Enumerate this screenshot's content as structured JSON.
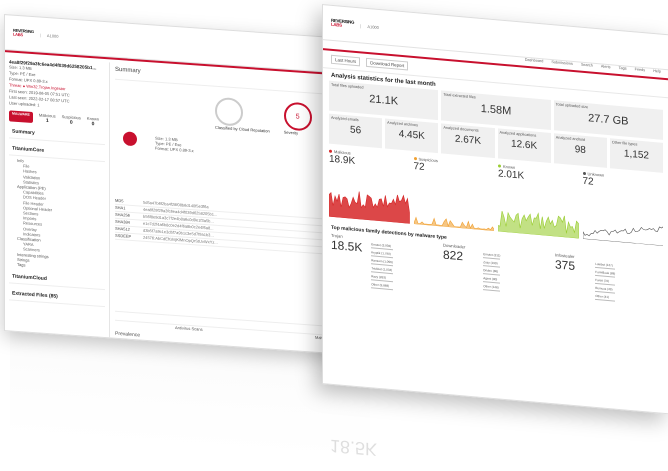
{
  "brand": {
    "logo_line1": "REVERSING",
    "logo_line2": "LABS",
    "product": "A1000"
  },
  "detail": {
    "hash": "4ea8f29f29a3fc6ea4d4f039d6258205b1...",
    "size": "Size: 1.3 MB",
    "type": "Type: PE / Exe",
    "format": "Format: UPX 0.89-3.x",
    "threat": "Threat: ● Win32.Trojan.Ingestor",
    "first_seen": "First seen: 2019-06-05 07:51 UTC",
    "last_seen": "Last seen: 2022-02-17 08:57 UTC",
    "uploaded": "User uploaded: 1",
    "status_pill": "MALWARE",
    "counts": [
      {
        "label": "Malicious",
        "value": "1"
      },
      {
        "label": "Suspicious",
        "value": "0"
      },
      {
        "label": "Known",
        "value": "0"
      }
    ],
    "nav": [
      {
        "kind": "sec",
        "label": "Summary"
      },
      {
        "kind": "sec",
        "label": "TitaniumCore"
      },
      {
        "kind": "sub",
        "label": "Info"
      },
      {
        "kind": "sub2",
        "label": "File"
      },
      {
        "kind": "sub2",
        "label": "Hashes"
      },
      {
        "kind": "sub2",
        "label": "Validation"
      },
      {
        "kind": "sub2",
        "label": "Statistics"
      },
      {
        "kind": "sub",
        "label": "Application (PE)"
      },
      {
        "kind": "sub2",
        "label": "Capabilities"
      },
      {
        "kind": "sub2",
        "label": "DOS Header"
      },
      {
        "kind": "sub2",
        "label": "File Header"
      },
      {
        "kind": "sub2",
        "label": "Optional Header"
      },
      {
        "kind": "sub2",
        "label": "Sections"
      },
      {
        "kind": "sub2",
        "label": "Imports"
      },
      {
        "kind": "sub2",
        "label": "Resources"
      },
      {
        "kind": "sub2",
        "label": "Overlay"
      },
      {
        "kind": "sub2",
        "label": "Indicators"
      },
      {
        "kind": "sub",
        "label": "Classification"
      },
      {
        "kind": "sub2",
        "label": "YARA"
      },
      {
        "kind": "sub2",
        "label": "Scanners"
      },
      {
        "kind": "sub",
        "label": "Interesting strings"
      },
      {
        "kind": "sub",
        "label": "Strings"
      },
      {
        "kind": "sub",
        "label": "Tags"
      },
      {
        "kind": "sec",
        "label": "TitaniumCloud"
      },
      {
        "kind": "sec",
        "label": "Extracted Files (85)"
      }
    ],
    "summary_title": "Summary",
    "file_size": "Size: 1.3 MB",
    "file_type": "Type: PE / Exe",
    "file_format": "Format: UPX 0.89-3.x",
    "malware_label": "MALWARE",
    "circle1_caption": "Classified by Cloud Reputation",
    "circle2_value": "5",
    "circle2_caption": "Severity",
    "circle3_value": "5",
    "hashes": [
      {
        "k": "MD5",
        "v": "5d5a47b6f2ba4f28f08b6d140f5e3f6a"
      },
      {
        "k": "SHA1",
        "v": "4ea8f29f29a3fc6ea4d4f039d6258205b1..."
      },
      {
        "k": "SHA256",
        "v": "b56f8e9d1a3c7f2e4b8a6c0d9e1f3a5b..."
      },
      {
        "k": "SHA384",
        "v": "e1c7d2f4a6b8c0e2d4f6a8b0c2e4f6a8..."
      },
      {
        "k": "SHA512",
        "v": "d3b5f7a9c1e3d5f7a9b1c3e5d7f9a1b3..."
      },
      {
        "k": "SSDEEP",
        "v": "24576:AbCdEfGhIjKlMnOpQrStUvWxYz..."
      }
    ],
    "preview_label": "Prevalence",
    "antivirus_label": "Antivirus Scans",
    "malware_prev_label": "Malware Prevalence"
  },
  "dashboard": {
    "nav": [
      "Dashboard",
      "Submissions",
      "Search",
      "Alerts",
      "Tags",
      "Feeds",
      "Help"
    ],
    "buttons": [
      "Last Hours",
      "Download Report"
    ],
    "section_title": "Analysis statistics for the last month",
    "stats_top": [
      {
        "label": "Total files uploaded",
        "value": "21.1K"
      },
      {
        "label": "Total extracted files",
        "value": "1.58M"
      },
      {
        "label": "Total uploaded size",
        "value": "27.7 GB"
      }
    ],
    "stats_bottom": [
      {
        "label": "Analyzed emails",
        "value": "56"
      },
      {
        "label": "Analyzed archives",
        "value": "4.45K"
      },
      {
        "label": "Analyzed documents",
        "value": "2.67K"
      },
      {
        "label": "Analyzed applications",
        "value": "12.6K"
      },
      {
        "label": "Analyzed android",
        "value": "98"
      },
      {
        "label": "Other file types",
        "value": "1,152"
      }
    ],
    "trends": [
      {
        "name": "Malicious",
        "value": "18.9K",
        "color": "#d62728"
      },
      {
        "name": "Suspicious",
        "value": "72",
        "color": "#f0a030"
      },
      {
        "name": "Known",
        "value": "2.01K",
        "color": "#9acd32"
      },
      {
        "name": "Unknown",
        "value": "72",
        "color": "#555555"
      }
    ],
    "families_title": "Top malicious family detections by malware type",
    "families": [
      {
        "name": "Trojan",
        "value": "18.5K",
        "items": [
          "Emotet (3,936)",
          "Kryptik (1,790)",
          "Ransom (1,056)",
          "Trickbot (1,034)",
          "Razy (893)",
          "Other (9,888)"
        ]
      },
      {
        "name": "Downloader",
        "value": "822",
        "items": [
          "Emotet (311)",
          "Zusy (199)",
          "Dridex (86)",
          "Agent (80)",
          "Other (146)"
        ]
      },
      {
        "name": "Infostealer",
        "value": "375",
        "items": [
          "Lokibot (127)",
          "FormBook (88)",
          "Fareit (70)",
          "Remcos (49)",
          "Other (41)"
        ]
      }
    ]
  }
}
